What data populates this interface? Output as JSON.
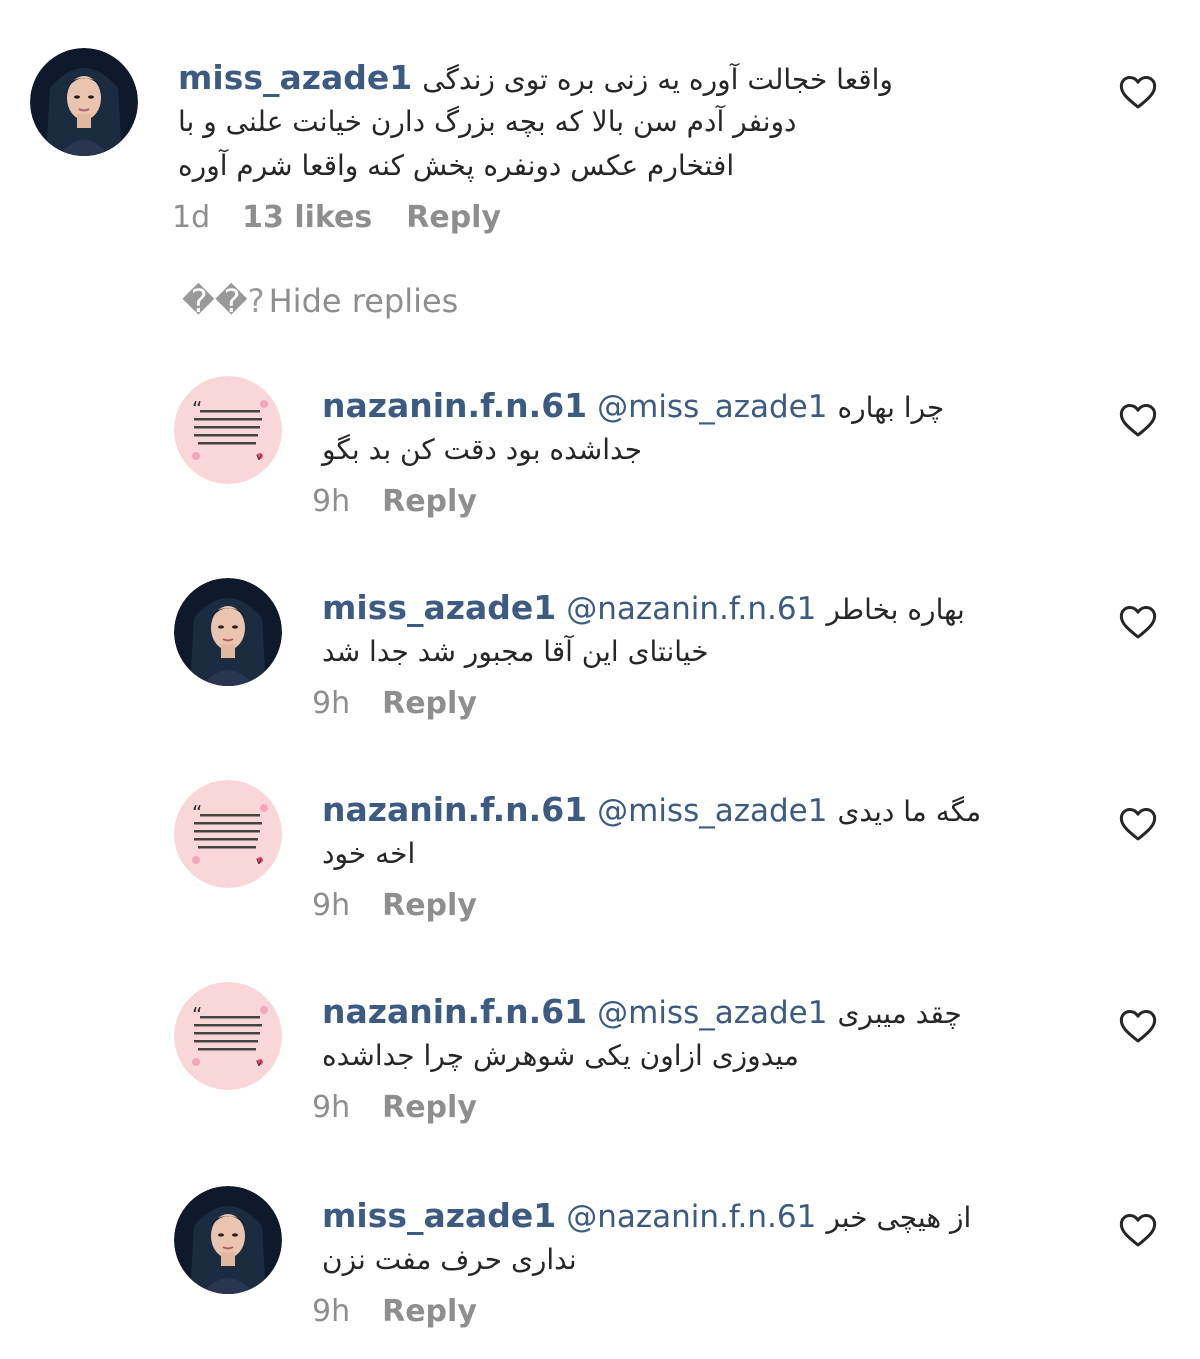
{
  "comment": {
    "username": "miss_azade1",
    "lines": [
      "واقعا خجالت آوره یه زنی بره توی زندگی",
      "دونفر آدم سن بالا که بچه بزرگ دارن خیانت علنی و با",
      "افتخارم عکس دونفره پخش کنه واقعا شرم آوره"
    ],
    "time": "1d",
    "likes": "13 likes",
    "reply": "Reply"
  },
  "hide_replies": {
    "prefix": "��?",
    "label": "Hide replies"
  },
  "replies": [
    {
      "username": "nazanin.f.n.61",
      "mention": "@miss_azade1",
      "line1": "چرا بهاره",
      "line2": "جداشده بود دقت کن بد بگو",
      "time": "9h",
      "reply": "Reply",
      "avatar": "pink-quote-avatar"
    },
    {
      "username": "miss_azade1",
      "mention": "@nazanin.f.n.61",
      "line1": "بهاره بخاطر",
      "line2": "خیانتای این آقا مجبور شد جدا شد",
      "time": "9h",
      "reply": "Reply",
      "avatar": "woman-portrait-avatar"
    },
    {
      "username": "nazanin.f.n.61",
      "mention": "@miss_azade1",
      "line1": "مگه ما دیدی",
      "line2": "اخه خود",
      "time": "9h",
      "reply": "Reply",
      "avatar": "pink-quote-avatar"
    },
    {
      "username": "nazanin.f.n.61",
      "mention": "@miss_azade1",
      "line1": "چقد میبری",
      "line2": "میدوزی ازاون یکی شوهرش چرا جداشده",
      "time": "9h",
      "reply": "Reply",
      "avatar": "pink-quote-avatar"
    },
    {
      "username": "miss_azade1",
      "mention": "@nazanin.f.n.61",
      "line1": "از هیچی خبر",
      "line2": "نداری حرف مفت نزن",
      "time": "9h",
      "reply": "Reply",
      "avatar": "woman-portrait-avatar"
    }
  ],
  "colors": {
    "username": "#3d5a80",
    "meta": "#8e8e8e",
    "text": "#262626",
    "pink_avatar_bg": "#f9d6d8"
  }
}
